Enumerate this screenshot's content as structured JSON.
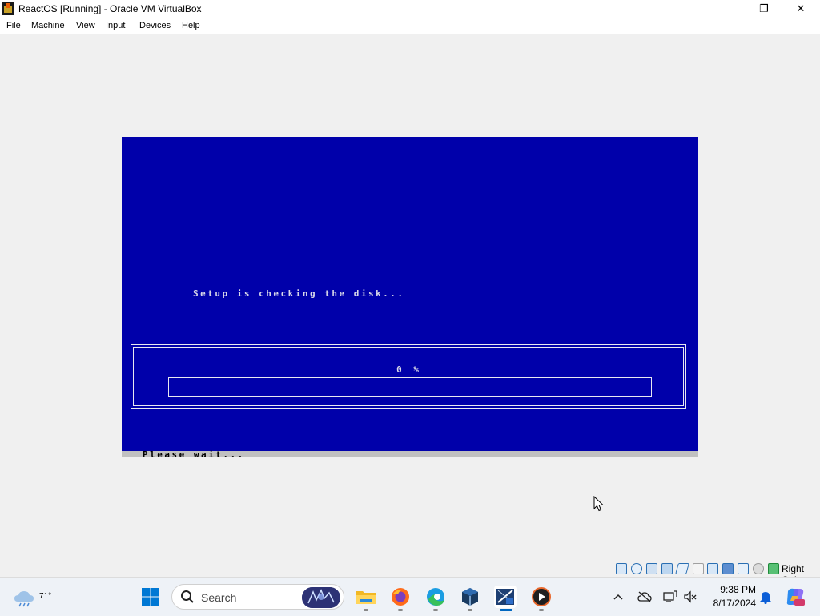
{
  "window": {
    "title": "ReactOS [Running] - Oracle VM VirtualBox",
    "controls": {
      "minimize": "—",
      "maximize": "❐",
      "close": "✕"
    }
  },
  "menu": [
    "File",
    "Machine",
    "View",
    "Input",
    "Devices",
    "Help"
  ],
  "vm": {
    "message": "Setup is checking the disk...",
    "progress_text": "0 %",
    "progress_value": 0,
    "status_text": "Please wait..."
  },
  "vbox_status": {
    "host_key": "Right Ctrl",
    "icons": [
      "hard-disk-icon",
      "optical-drive-icon",
      "audio-icon",
      "network-icon",
      "usb-icon",
      "shared-folders-icon",
      "display-icon",
      "recording-icon",
      "vt-x-icon",
      "mouse-integration-icon",
      "keyboard-capture-icon"
    ]
  },
  "taskbar": {
    "weather_temp": "71°",
    "search_label": "Search",
    "apps": [
      "start-icon",
      "file-explorer-icon",
      "firefox-icon",
      "edge-icon",
      "virtualbox-icon",
      "reactos-setup-icon",
      "media-player-icon"
    ],
    "clock_time": "9:38 PM",
    "clock_date": "8/17/2024"
  },
  "colors": {
    "vm_background": "#0000aa",
    "vm_text": "#d8d8e8",
    "host_background": "#f0f0f0",
    "accent": "#0067c0"
  }
}
